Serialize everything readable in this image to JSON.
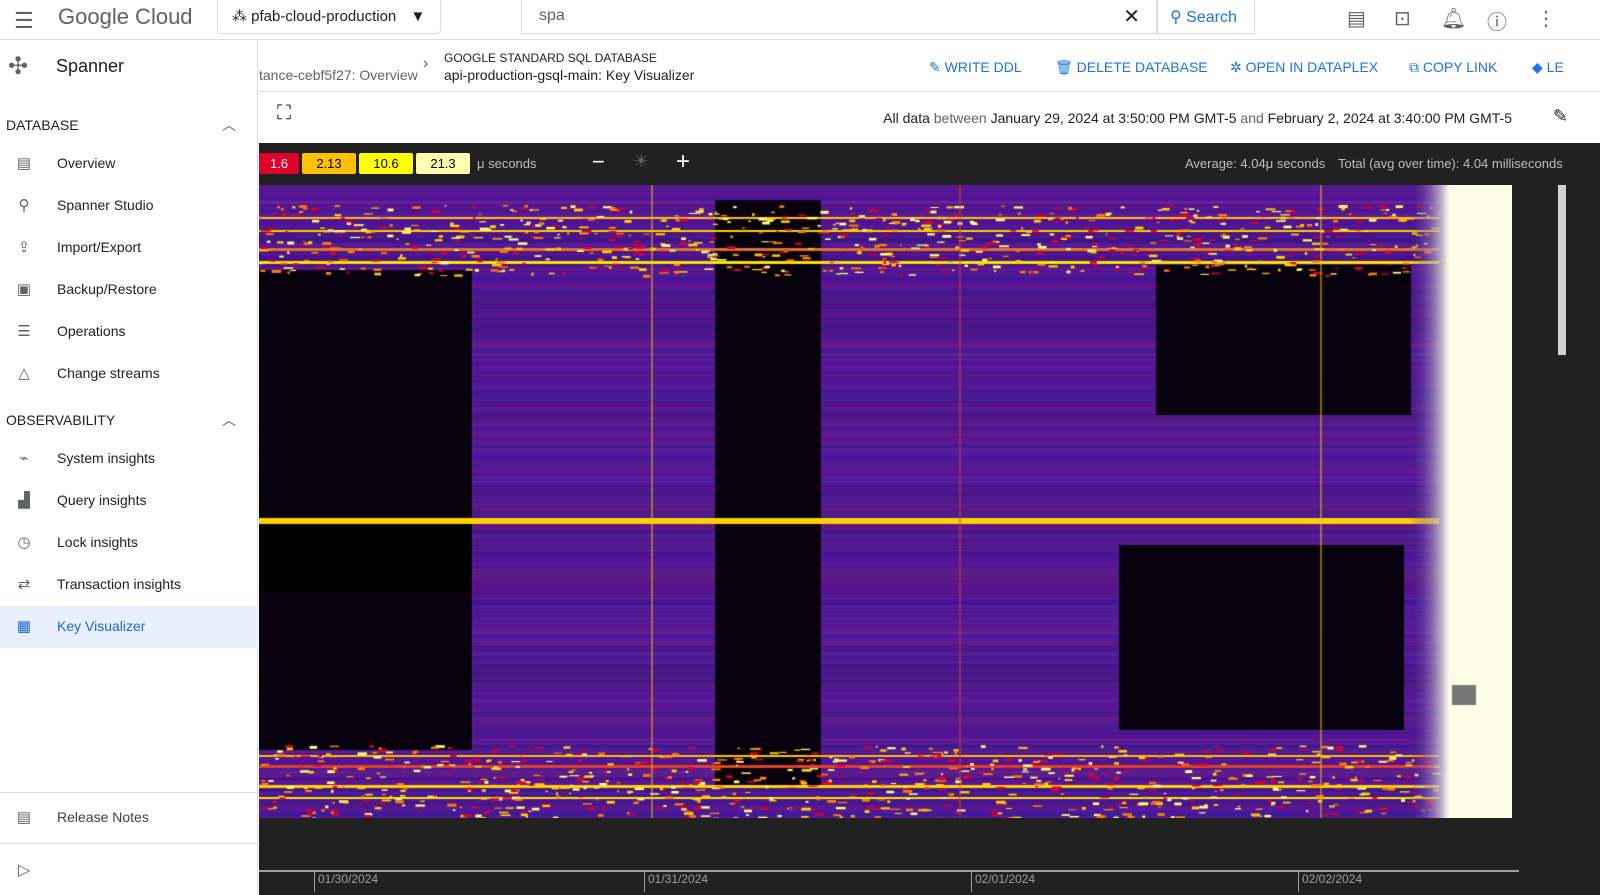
{
  "topbar": {
    "logo": "Google Cloud",
    "project": "pfab-cloud-production",
    "search_value": "spa",
    "search_button": "Search"
  },
  "sidebar": {
    "product": "Spanner",
    "sections": [
      {
        "title": "DATABASE",
        "items": [
          {
            "label": "Overview",
            "icon": "overview-icon",
            "glyph": "▤"
          },
          {
            "label": "Spanner Studio",
            "icon": "search-icon",
            "glyph": "⚲"
          },
          {
            "label": "Import/Export",
            "icon": "upload-icon",
            "glyph": "⇪"
          },
          {
            "label": "Backup/Restore",
            "icon": "backup-icon",
            "glyph": "▣"
          },
          {
            "label": "Operations",
            "icon": "list-icon",
            "glyph": "☰"
          },
          {
            "label": "Change streams",
            "icon": "triangle-icon",
            "glyph": "△"
          }
        ]
      },
      {
        "title": "OBSERVABILITY",
        "items": [
          {
            "label": "System insights",
            "icon": "monitor-icon",
            "glyph": "⌁"
          },
          {
            "label": "Query insights",
            "icon": "chart-icon",
            "glyph": "▟"
          },
          {
            "label": "Lock insights",
            "icon": "timer-icon",
            "glyph": "◷"
          },
          {
            "label": "Transaction insights",
            "icon": "swap-icon",
            "glyph": "⇄"
          },
          {
            "label": "Key Visualizer",
            "icon": "grid-icon",
            "glyph": "▦",
            "active": true
          }
        ]
      }
    ],
    "release_notes": "Release Notes"
  },
  "header": {
    "breadcrumb": "tance-cebf5f27: Overview",
    "db_type": "GOOGLE STANDARD SQL DATABASE",
    "db_name": "api-production-gsql-main: Key Visualizer",
    "actions": [
      {
        "label": "WRITE DDL",
        "icon": "pencil-icon",
        "glyph": "✎"
      },
      {
        "label": "DELETE DATABASE",
        "icon": "trash-icon",
        "glyph": "🗑"
      },
      {
        "label": "OPEN IN DATAPLEX",
        "icon": "dataplex-icon",
        "glyph": "✲"
      },
      {
        "label": "COPY LINK",
        "icon": "copy-icon",
        "glyph": "⧉"
      },
      {
        "label": "LE",
        "icon": "school-icon",
        "glyph": "◆"
      }
    ]
  },
  "range": {
    "prefix": "All data",
    "between": "between",
    "start": "January 29, 2024 at 3:50:00 PM GMT-5",
    "and": "and",
    "end": "February 2, 2024 at 3:40:00 PM GMT-5"
  },
  "legend": {
    "values": [
      "1.6",
      "2.13",
      "10.6",
      "21.3"
    ],
    "colors": [
      "#e0002a",
      "#ffc000",
      "#ffff00",
      "#ffffb0"
    ],
    "unit": "μ seconds"
  },
  "stats": {
    "average": "Average: 4.04μ seconds",
    "total": "Total (avg over time): 4.04 milliseconds"
  },
  "axis": {
    "ticks": [
      "01/30/2024",
      "01/31/2024",
      "02/01/2024",
      "02/02/2024"
    ]
  }
}
